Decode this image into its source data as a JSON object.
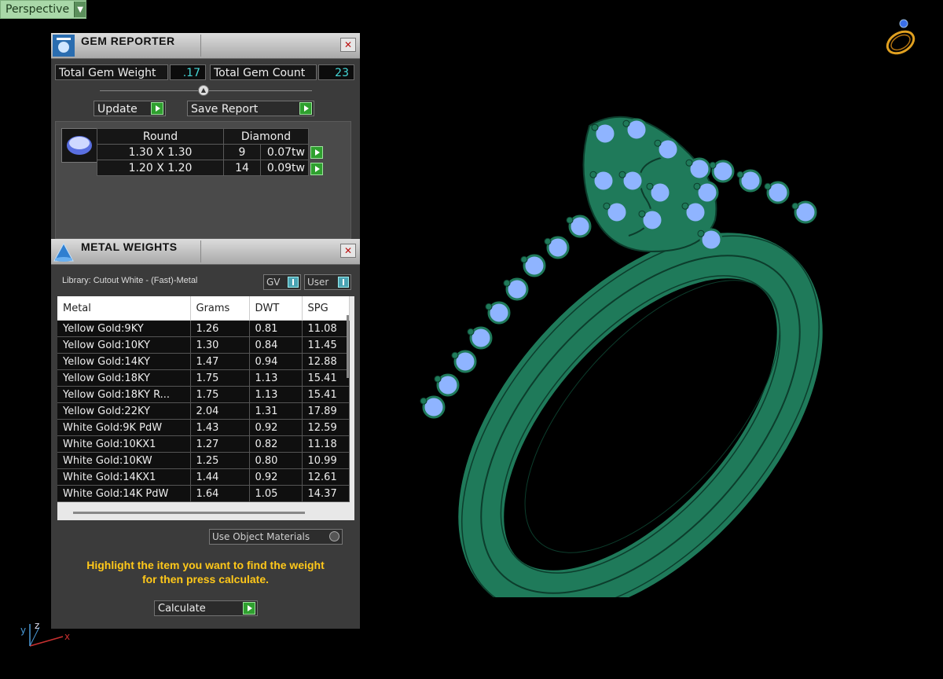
{
  "viewport": {
    "label": "Perspective"
  },
  "gem_reporter": {
    "title": "GEM REPORTER",
    "total_weight_label": "Total Gem Weight",
    "total_weight_value": ".17",
    "total_count_label": "Total Gem Count",
    "total_count_value": "23",
    "update_label": "Update",
    "save_label": "Save Report",
    "table": {
      "shape": "Round",
      "material": "Diamond",
      "rows": [
        {
          "size": "1.30 X 1.30",
          "count": "9",
          "weight": "0.07tw"
        },
        {
          "size": "1.20 X 1.20",
          "count": "14",
          "weight": "0.09tw"
        }
      ]
    }
  },
  "metal_weights": {
    "title": "METAL WEIGHTS",
    "library": "Library: Cutout White - (Fast)-Metal",
    "gv_label": "GV",
    "user_label": "User",
    "columns": [
      "Metal",
      "Grams",
      "DWT",
      "SPG"
    ],
    "rows": [
      [
        "Yellow Gold:9KY",
        "1.26",
        "0.81",
        "11.08"
      ],
      [
        "Yellow Gold:10KY",
        "1.30",
        "0.84",
        "11.45"
      ],
      [
        "Yellow Gold:14KY",
        "1.47",
        "0.94",
        "12.88"
      ],
      [
        "Yellow Gold:18KY",
        "1.75",
        "1.13",
        "15.41"
      ],
      [
        "Yellow Gold:18KY R...",
        "1.75",
        "1.13",
        "15.41"
      ],
      [
        "Yellow Gold:22KY",
        "2.04",
        "1.31",
        "17.89"
      ],
      [
        "White Gold:9K PdW",
        "1.43",
        "0.92",
        "12.59"
      ],
      [
        "White Gold:10KX1",
        "1.27",
        "0.82",
        "11.18"
      ],
      [
        "White Gold:10KW",
        "1.25",
        "0.80",
        "10.99"
      ],
      [
        "White Gold:14KX1",
        "1.44",
        "0.92",
        "12.61"
      ],
      [
        "White Gold:14K PdW",
        "1.64",
        "1.05",
        "14.37"
      ]
    ],
    "use_object_materials": "Use Object Materials",
    "note_line1": "Highlight the item you want to find the weight",
    "note_line2": "for then press calculate.",
    "calculate_label": "Calculate"
  },
  "axis": {
    "y": "y",
    "z": "z",
    "x": "x"
  },
  "colors": {
    "ring": "#1f7a5a",
    "ring_edge": "#0c3d2c",
    "gem": "#8fb4ff",
    "panel": "#3b3b3b",
    "accent_text": "#ffc81a"
  }
}
